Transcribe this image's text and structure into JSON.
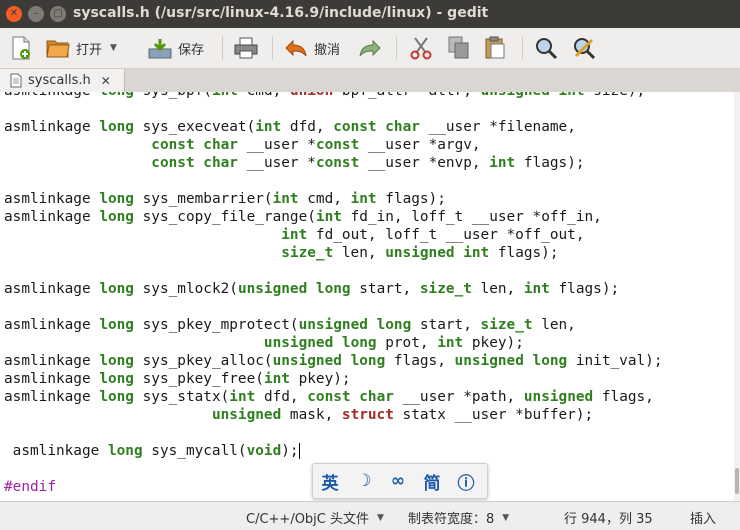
{
  "window": {
    "title": "syscalls.h (/usr/src/linux-4.16.9/include/linux) - gedit"
  },
  "toolbar": {
    "new_icon": "new-document-icon",
    "open_label": "打开",
    "save_label": "保存",
    "print_icon": "print-icon",
    "undo_label": "撤消",
    "redo_icon": "redo-icon",
    "cut_icon": "cut-icon",
    "copy_icon": "copy-icon",
    "paste_icon": "paste-icon",
    "find_icon": "search-icon",
    "replace_icon": "find-replace-icon"
  },
  "tab": {
    "label": "syscalls.h",
    "close": "✕"
  },
  "editor": {
    "lines": [
      [
        [
          "asmlinkage ",
          ""
        ],
        [
          "long",
          "kw"
        ],
        [
          " sys_bpf(",
          ""
        ],
        [
          "int",
          "kw"
        ],
        [
          " cmd, ",
          ""
        ],
        [
          "union",
          "kr"
        ],
        [
          " bpf_attr *attr, ",
          ""
        ],
        [
          "unsigned",
          "kw"
        ],
        [
          " ",
          ""
        ],
        [
          "int",
          "kw"
        ],
        [
          " size);",
          ""
        ]
      ],
      [],
      [
        [
          "asmlinkage ",
          ""
        ],
        [
          "long",
          "kw"
        ],
        [
          " sys_execveat(",
          ""
        ],
        [
          "int",
          "kw"
        ],
        [
          " dfd, ",
          ""
        ],
        [
          "const",
          "kw"
        ],
        [
          " ",
          ""
        ],
        [
          "char",
          "kw"
        ],
        [
          " __user *filename,",
          ""
        ]
      ],
      [
        [
          "                 ",
          ""
        ],
        [
          "const",
          "kw"
        ],
        [
          " ",
          ""
        ],
        [
          "char",
          "kw"
        ],
        [
          " __user *",
          ""
        ],
        [
          "const",
          "kw"
        ],
        [
          " __user *argv,",
          ""
        ]
      ],
      [
        [
          "                 ",
          ""
        ],
        [
          "const",
          "kw"
        ],
        [
          " ",
          ""
        ],
        [
          "char",
          "kw"
        ],
        [
          " __user *",
          ""
        ],
        [
          "const",
          "kw"
        ],
        [
          " __user *envp, ",
          ""
        ],
        [
          "int",
          "kw"
        ],
        [
          " flags);",
          ""
        ]
      ],
      [],
      [
        [
          "asmlinkage ",
          ""
        ],
        [
          "long",
          "kw"
        ],
        [
          " sys_membarrier(",
          ""
        ],
        [
          "int",
          "kw"
        ],
        [
          " cmd, ",
          ""
        ],
        [
          "int",
          "kw"
        ],
        [
          " flags);",
          ""
        ]
      ],
      [
        [
          "asmlinkage ",
          ""
        ],
        [
          "long",
          "kw"
        ],
        [
          " sys_copy_file_range(",
          ""
        ],
        [
          "int",
          "kw"
        ],
        [
          " fd_in, loff_t __user *off_in,",
          ""
        ]
      ],
      [
        [
          "                                ",
          ""
        ],
        [
          "int",
          "kw"
        ],
        [
          " fd_out, loff_t __user *off_out,",
          ""
        ]
      ],
      [
        [
          "                                ",
          ""
        ],
        [
          "size_t",
          "kw"
        ],
        [
          " len, ",
          ""
        ],
        [
          "unsigned",
          "kw"
        ],
        [
          " ",
          ""
        ],
        [
          "int",
          "kw"
        ],
        [
          " flags);",
          ""
        ]
      ],
      [],
      [
        [
          "asmlinkage ",
          ""
        ],
        [
          "long",
          "kw"
        ],
        [
          " sys_mlock2(",
          ""
        ],
        [
          "unsigned",
          "kw"
        ],
        [
          " ",
          ""
        ],
        [
          "long",
          "kw"
        ],
        [
          " start, ",
          ""
        ],
        [
          "size_t",
          "kw"
        ],
        [
          " len, ",
          ""
        ],
        [
          "int",
          "kw"
        ],
        [
          " flags);",
          ""
        ]
      ],
      [],
      [
        [
          "asmlinkage ",
          ""
        ],
        [
          "long",
          "kw"
        ],
        [
          " sys_pkey_mprotect(",
          ""
        ],
        [
          "unsigned",
          "kw"
        ],
        [
          " ",
          ""
        ],
        [
          "long",
          "kw"
        ],
        [
          " start, ",
          ""
        ],
        [
          "size_t",
          "kw"
        ],
        [
          " len,",
          ""
        ]
      ],
      [
        [
          "                              ",
          ""
        ],
        [
          "unsigned",
          "kw"
        ],
        [
          " ",
          ""
        ],
        [
          "long",
          "kw"
        ],
        [
          " prot, ",
          ""
        ],
        [
          "int",
          "kw"
        ],
        [
          " pkey);",
          ""
        ]
      ],
      [
        [
          "asmlinkage ",
          ""
        ],
        [
          "long",
          "kw"
        ],
        [
          " sys_pkey_alloc(",
          ""
        ],
        [
          "unsigned",
          "kw"
        ],
        [
          " ",
          ""
        ],
        [
          "long",
          "kw"
        ],
        [
          " flags, ",
          ""
        ],
        [
          "unsigned",
          "kw"
        ],
        [
          " ",
          ""
        ],
        [
          "long",
          "kw"
        ],
        [
          " init_val);",
          ""
        ]
      ],
      [
        [
          "asmlinkage ",
          ""
        ],
        [
          "long",
          "kw"
        ],
        [
          " sys_pkey_free(",
          ""
        ],
        [
          "int",
          "kw"
        ],
        [
          " pkey);",
          ""
        ]
      ],
      [
        [
          "asmlinkage ",
          ""
        ],
        [
          "long",
          "kw"
        ],
        [
          " sys_statx(",
          ""
        ],
        [
          "int",
          "kw"
        ],
        [
          " dfd, ",
          ""
        ],
        [
          "const",
          "kw"
        ],
        [
          " ",
          ""
        ],
        [
          "char",
          "kw"
        ],
        [
          " __user *path, ",
          ""
        ],
        [
          "unsigned",
          "kw"
        ],
        [
          " flags,",
          ""
        ]
      ],
      [
        [
          "                        ",
          ""
        ],
        [
          "unsigned",
          "kw"
        ],
        [
          " mask, ",
          ""
        ],
        [
          "struct",
          "kr"
        ],
        [
          " statx __user *buffer);",
          ""
        ]
      ],
      [],
      [
        [
          " asmlinkage ",
          ""
        ],
        [
          "long",
          "kw"
        ],
        [
          " sys_mycall(",
          ""
        ],
        [
          "void",
          "kw"
        ],
        [
          ");",
          ""
        ],
        [
          "|",
          "cursor"
        ]
      ],
      [],
      [
        [
          "#endif",
          "pp"
        ]
      ]
    ]
  },
  "ime": {
    "items": [
      "英",
      "☽",
      "∞",
      "简",
      "ⓘ"
    ]
  },
  "status": {
    "language": "C/C++/ObjC 头文件",
    "tab_width": "制表符宽度：8",
    "position": "行 944，列 35",
    "mode": "插入"
  }
}
